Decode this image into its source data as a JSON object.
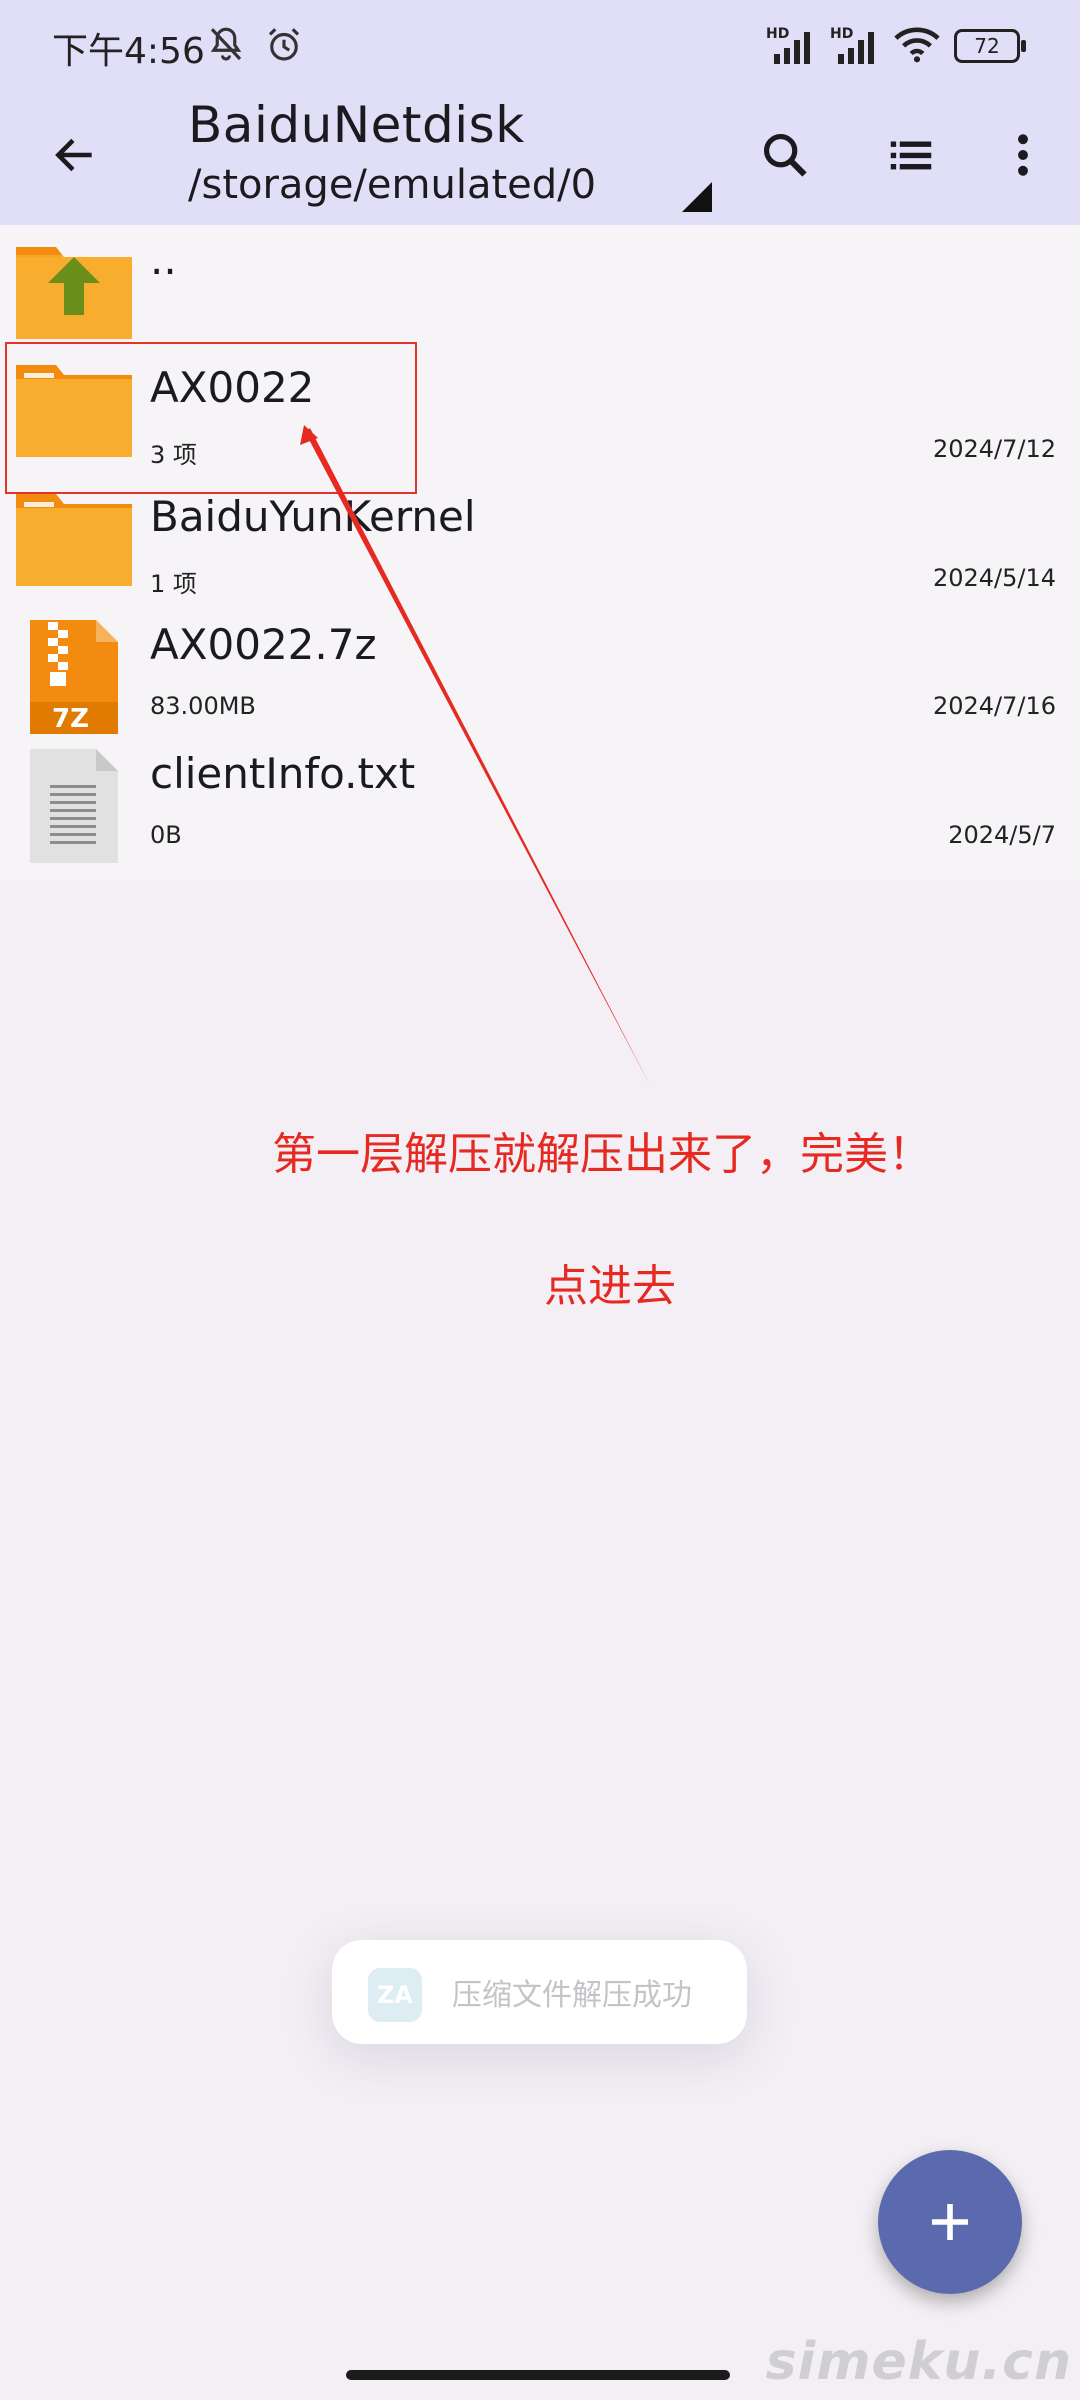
{
  "status_bar": {
    "time": "下午4:56",
    "left_icons": [
      "bell-off-icon",
      "alarm-icon"
    ],
    "signal_1_label": "HD",
    "signal_2_label": "HD",
    "battery": "72"
  },
  "app_bar": {
    "title": "BaiduNetdisk",
    "path": "/storage/emulated/0",
    "back_icon": "arrow-left-icon",
    "search_icon": "search-icon",
    "list_icon": "list-view-icon",
    "more_icon": "more-vert-icon"
  },
  "files": [
    {
      "name": "..",
      "meta": "",
      "date": "",
      "icon": "folder-up-icon"
    },
    {
      "name": "AX0022",
      "meta": "3 项",
      "date": "2024/7/12",
      "icon": "folder-icon"
    },
    {
      "name": "BaiduYunKernel",
      "meta": "1 项",
      "date": "2024/5/14",
      "icon": "folder-icon"
    },
    {
      "name": "AX0022.7z",
      "meta": "83.00MB",
      "date": "2024/7/16",
      "icon": "archive-7z-icon",
      "icon_label": "7Z"
    },
    {
      "name": "clientInfo.txt",
      "meta": "0B",
      "date": "2024/5/7",
      "icon": "text-file-icon"
    }
  ],
  "annotation": {
    "line1": "第一层解压就解压出来了，完美！",
    "line2": "点进去",
    "color": "#e62a22"
  },
  "toast": {
    "icon_label": "ZA",
    "message": "压缩文件解压成功"
  },
  "fab": {
    "icon": "plus-icon"
  },
  "watermark": "simeku.cn",
  "colors": {
    "app_bar": "#e0dff7",
    "background": "#f3eff4",
    "folder": "#f5a623",
    "fab": "#5b6aae"
  }
}
